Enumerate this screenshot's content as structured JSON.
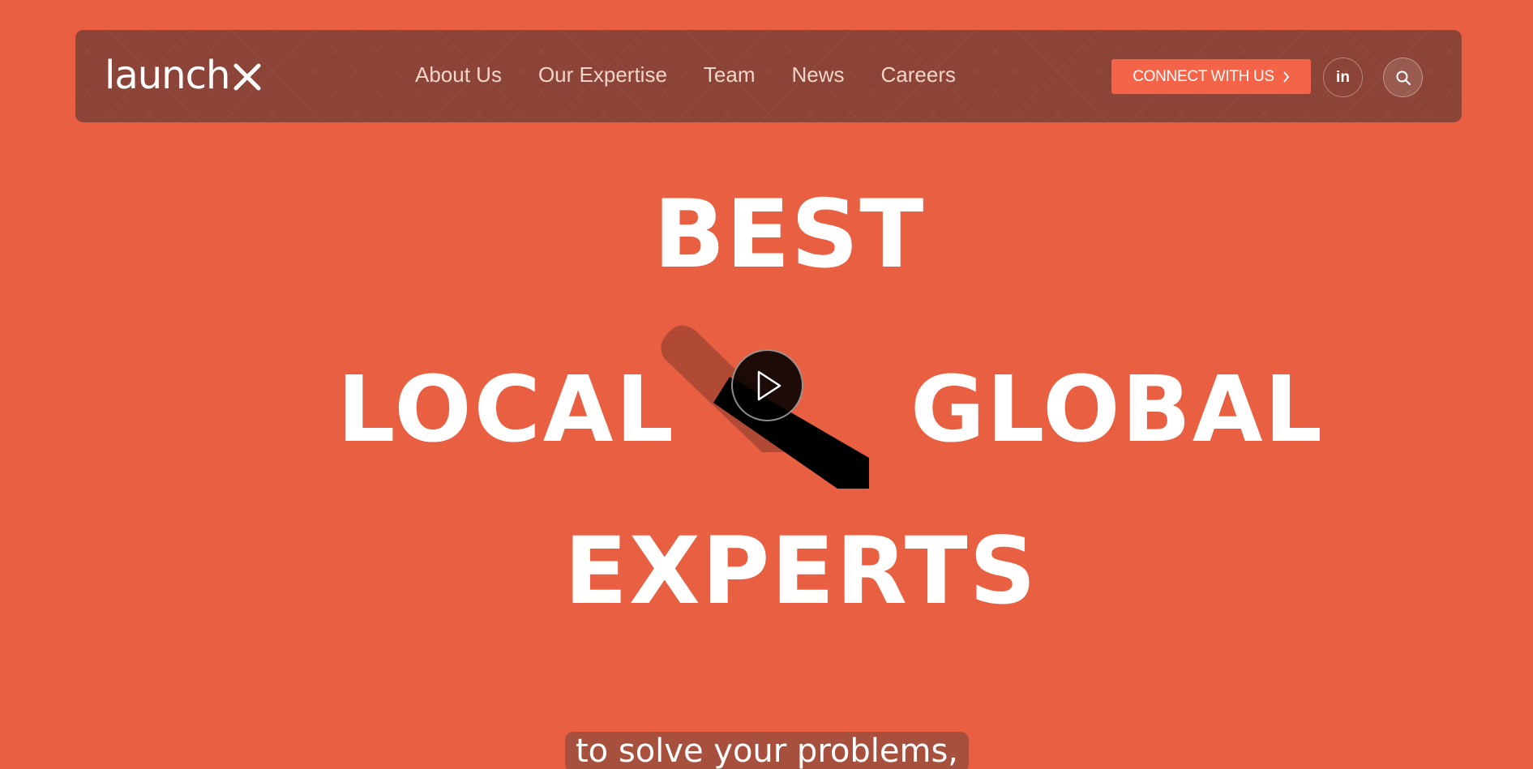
{
  "header": {
    "logo_text": "launch",
    "logo_mark": "X",
    "nav": [
      {
        "label": "About Us"
      },
      {
        "label": "Our Expertise"
      },
      {
        "label": "Team"
      },
      {
        "label": "News"
      },
      {
        "label": "Careers"
      }
    ],
    "cta_label": "CONNECT WITH US",
    "linkedin_label": "in"
  },
  "hero": {
    "line_1": "BEST",
    "line_2_left": "LOCAL",
    "line_2_right": "GLOBAL",
    "line_3": "EXPERTS",
    "subtitle": "to solve your problems,"
  },
  "colors": {
    "background": "#e85f42",
    "navbar": "#8b4437",
    "cta": "#f46448",
    "text": "#ffffff",
    "slash_shadow": "#b14a34",
    "slash_main": "#000000"
  },
  "icons": {
    "cta_arrow": "chevron-right-icon",
    "linkedin": "linkedin-icon",
    "search": "search-icon",
    "play": "play-icon"
  }
}
